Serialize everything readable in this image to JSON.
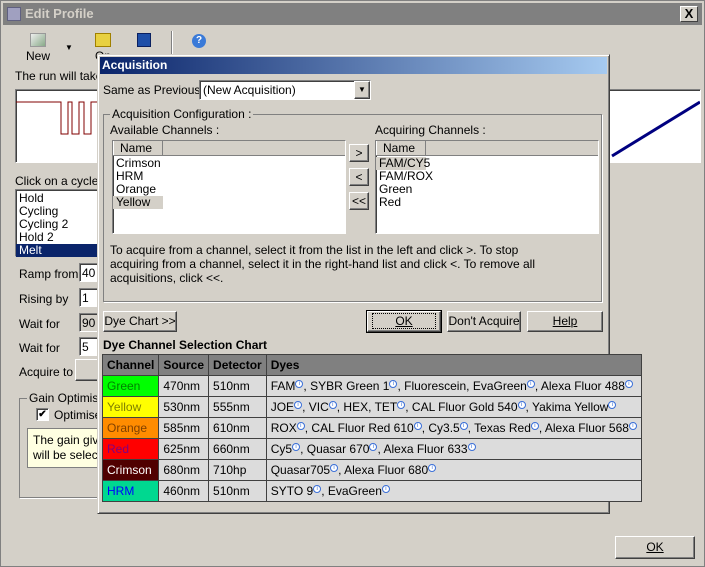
{
  "window": {
    "title": "Edit Profile",
    "close": "X",
    "ok": "OK"
  },
  "toolbar": {
    "new": "New",
    "open": "Op"
  },
  "main": {
    "run_text": "The run will take",
    "cycle_text": "Click on a cycle b",
    "cycles": [
      "Hold",
      "Cycling",
      "Cycling 2",
      "Hold 2",
      "Melt"
    ],
    "selected_cycle": 4,
    "fields": [
      {
        "label": "Ramp from",
        "value": "40"
      },
      {
        "label": "Rising by",
        "value": "1"
      },
      {
        "label": "Wait for",
        "value": "90"
      },
      {
        "label": "Wait for",
        "value": "5"
      }
    ],
    "acquire_to": "Acquire to",
    "gain_group": "Gain Optimisat",
    "optimise": "Optimise",
    "gain_note_1": "The gain givin",
    "gain_note_2": "will be selecte"
  },
  "dialog": {
    "title": "Acquisition",
    "same_as_prev_label": "Same as Previous :",
    "same_as_prev_value": "(New Acquisition)",
    "config_group": "Acquisition Configuration :",
    "available_label": "Available Channels :",
    "acquiring_label": "Acquiring Channels :",
    "name_col": "Name",
    "available": [
      "Crimson",
      "HRM",
      "Orange",
      "Yellow"
    ],
    "available_selected": 3,
    "acquiring": [
      "FAM/CY5",
      "FAM/ROX",
      "Green",
      "Red"
    ],
    "acquiring_selected": 0,
    "add": ">",
    "remove": "<",
    "remove_all": "<<",
    "help_text": "To acquire from a channel, select it from the list in the left and click >. To stop acquiring from a channel, select it in the right-hand list and click <. To remove all acquisitions, click <<.",
    "dye_chart_btn": "Dye Chart >>",
    "ok": "OK",
    "dont_acquire": "Don't Acquire",
    "help": "Help",
    "chart_title": "Dye Channel Selection Chart",
    "columns": [
      "Channel",
      "Source",
      "Detector",
      "Dyes"
    ],
    "rows": [
      {
        "channel": "Green",
        "bg": "#00ff00",
        "fg": "#008000",
        "source": "470nm",
        "detector": "510nm",
        "dyes": [
          [
            "FAM",
            1
          ],
          [
            "SYBR Green 1",
            1
          ],
          [
            "Fluorescein",
            0
          ],
          [
            "EvaGreen",
            1
          ],
          [
            "Alexa Fluor 488",
            1
          ]
        ]
      },
      {
        "channel": "Yellow",
        "bg": "#ffff00",
        "fg": "#808000",
        "source": "530nm",
        "detector": "555nm",
        "dyes": [
          [
            "JOE",
            1
          ],
          [
            "VIC",
            1
          ],
          [
            "HEX",
            0
          ],
          [
            "TET",
            1
          ],
          [
            "CAL Fluor Gold 540",
            1
          ],
          [
            "Yakima Yellow",
            1
          ]
        ]
      },
      {
        "channel": "Orange",
        "bg": "#ff8c00",
        "fg": "#804000",
        "source": "585nm",
        "detector": "610nm",
        "dyes": [
          [
            "ROX",
            1
          ],
          [
            "CAL Fluor Red 610",
            1
          ],
          [
            "Cy3.5",
            1
          ],
          [
            "Texas Red",
            1
          ],
          [
            "Alexa Fluor 568",
            1
          ]
        ]
      },
      {
        "channel": "Red",
        "bg": "#ff0000",
        "fg": "#800080",
        "source": "625nm",
        "detector": "660nm",
        "dyes": [
          [
            "Cy5",
            1
          ],
          [
            "Quasar 670",
            1
          ],
          [
            "Alexa Fluor 633",
            1
          ]
        ]
      },
      {
        "channel": "Crimson",
        "bg": "#500000",
        "fg": "#ffffff",
        "source": "680nm",
        "detector": "710hp",
        "dyes": [
          [
            "Quasar705",
            1
          ],
          [
            "Alexa Fluor 680",
            1
          ]
        ]
      },
      {
        "channel": "HRM",
        "bg": "#00d890",
        "fg": "#0000ff",
        "source": "460nm",
        "detector": "510nm",
        "dyes": [
          [
            "SYTO 9",
            1
          ],
          [
            "EvaGreen",
            1
          ]
        ]
      }
    ]
  }
}
